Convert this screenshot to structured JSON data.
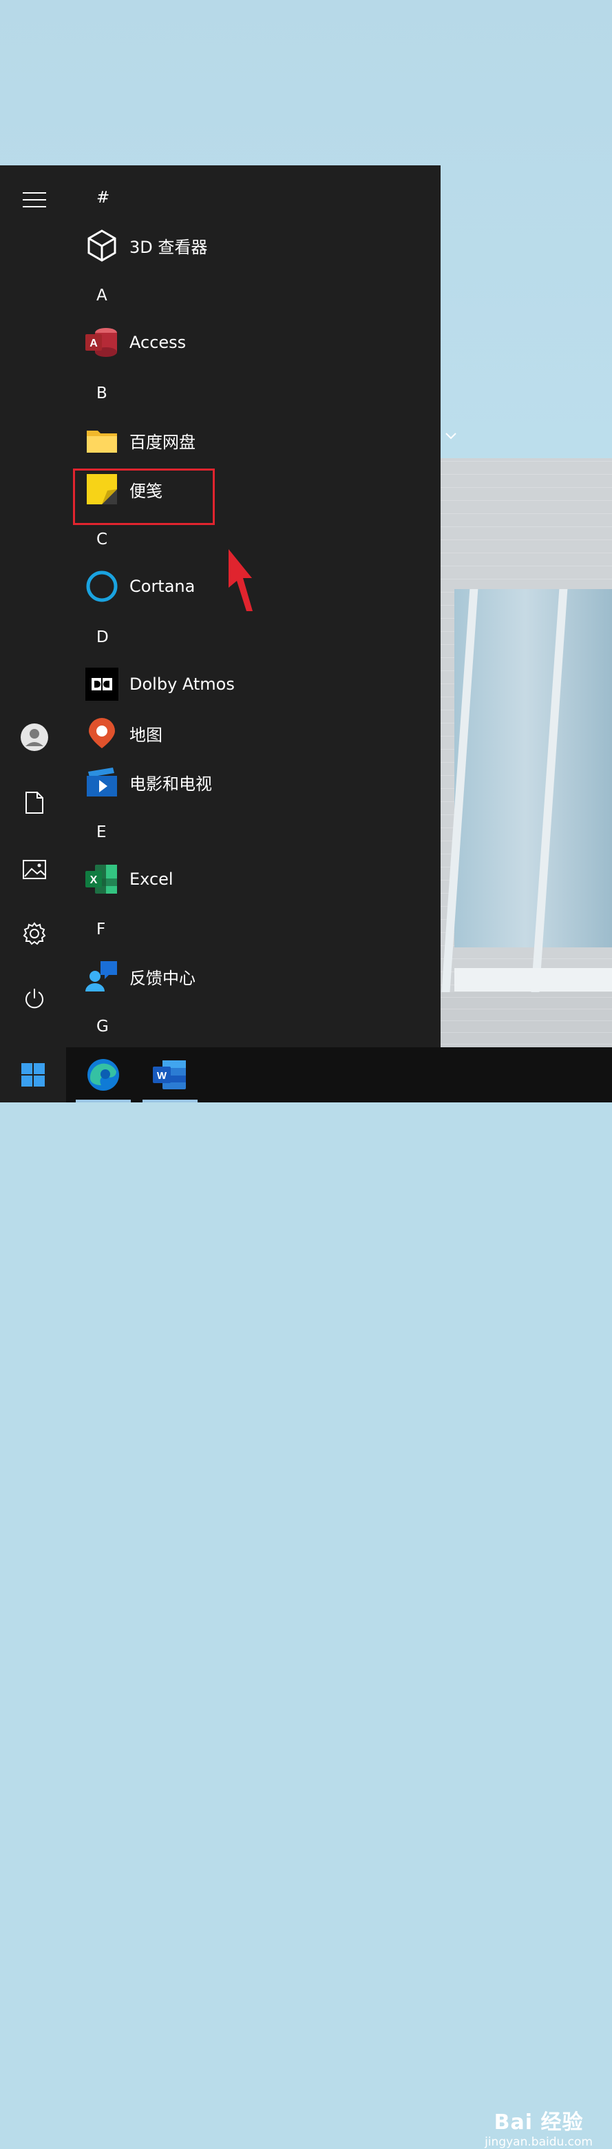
{
  "start_menu": {
    "groups": [
      {
        "letter": "#",
        "apps": [
          {
            "label": "3D 查看器",
            "icon": "cube-icon"
          }
        ]
      },
      {
        "letter": "A",
        "apps": [
          {
            "label": "Access",
            "icon": "access-icon"
          }
        ]
      },
      {
        "letter": "B",
        "apps": [
          {
            "label": "百度网盘",
            "icon": "folder-icon"
          },
          {
            "label": "便笺",
            "icon": "sticky-notes-icon"
          }
        ]
      },
      {
        "letter": "C",
        "apps": [
          {
            "label": "Cortana",
            "icon": "cortana-icon"
          }
        ]
      },
      {
        "letter": "D",
        "apps": [
          {
            "label": "Dolby Atmos",
            "icon": "dolby-icon"
          },
          {
            "label": "地图",
            "icon": "maps-icon"
          },
          {
            "label": "电影和电视",
            "icon": "movies-tv-icon"
          }
        ]
      },
      {
        "letter": "E",
        "apps": [
          {
            "label": "Excel",
            "icon": "excel-icon"
          }
        ]
      },
      {
        "letter": "F",
        "apps": [
          {
            "label": "反馈中心",
            "icon": "feedback-hub-icon"
          }
        ]
      },
      {
        "letter": "G",
        "apps": []
      }
    ]
  },
  "rail": [
    "hamburger-icon",
    "user-avatar-icon",
    "documents-icon",
    "pictures-icon",
    "settings-gear-icon",
    "power-icon"
  ],
  "taskbar": [
    "windows-start-icon",
    "edge-icon",
    "word-icon"
  ],
  "watermark": {
    "main": "Bai 经验",
    "sub": "jingyan.baidu.com"
  },
  "colors": {
    "menu_bg": "#1f1f1f",
    "highlight": "#e0242e",
    "sticky_yellow": "#f7d317"
  }
}
